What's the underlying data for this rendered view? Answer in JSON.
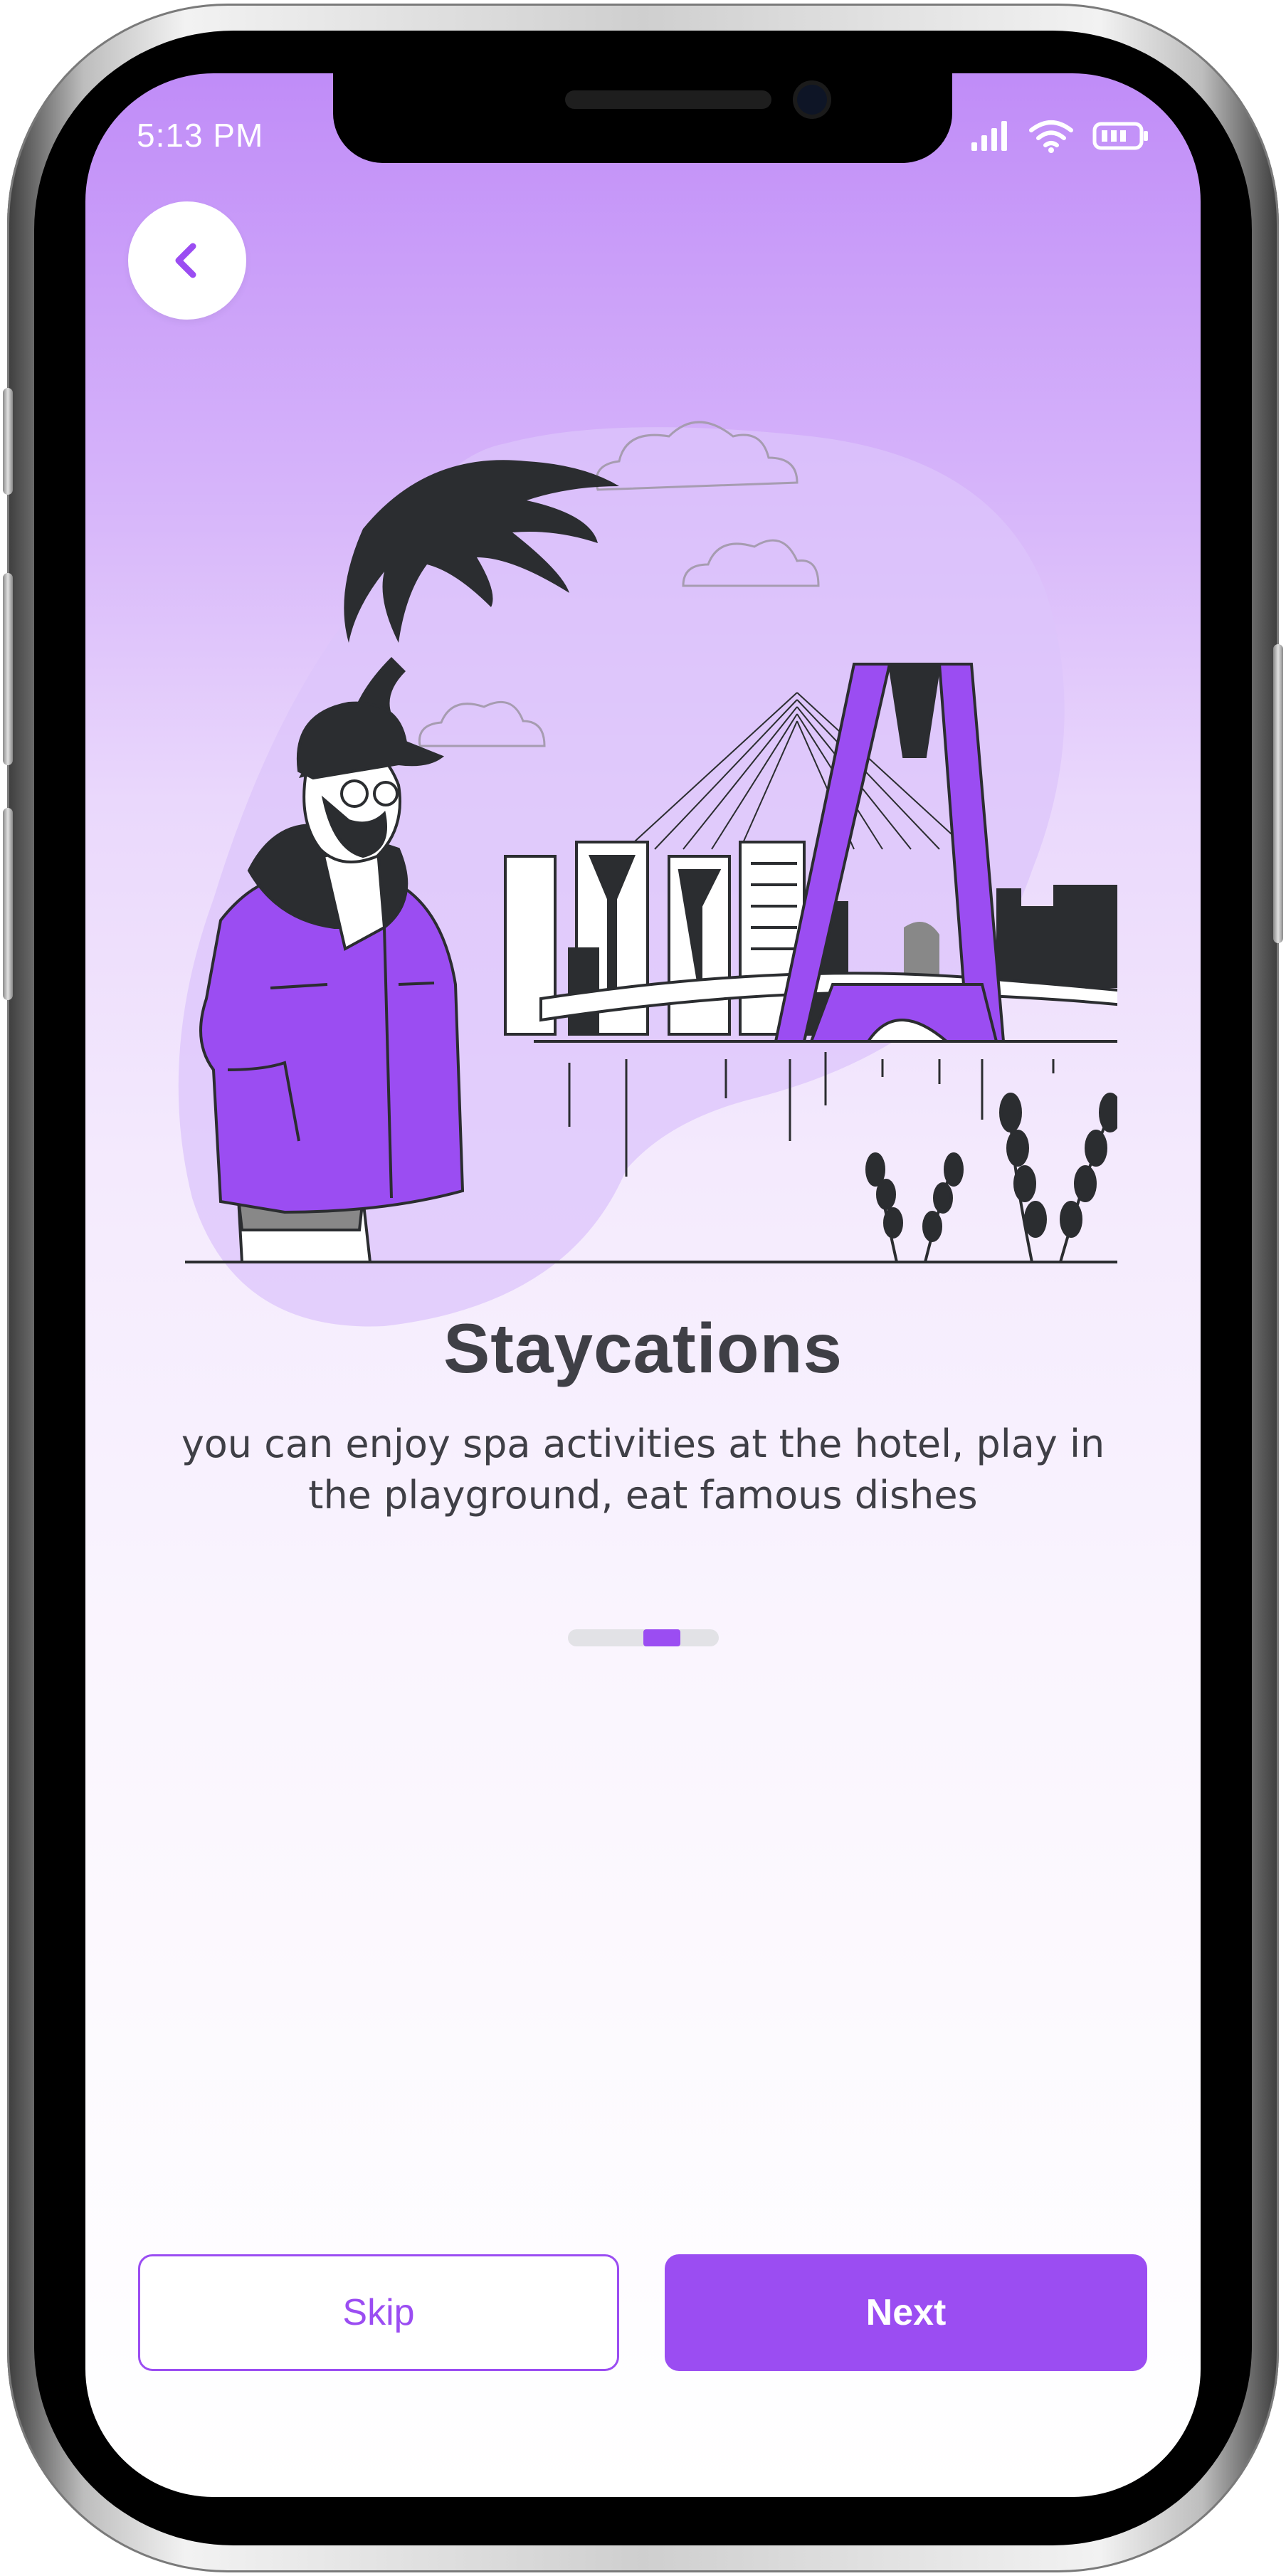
{
  "status_bar": {
    "time": "5:13 PM",
    "icons": [
      "signal-icon",
      "wifi-icon",
      "battery-icon"
    ]
  },
  "nav": {
    "back_icon": "chevron-left-icon"
  },
  "onboarding": {
    "title": "Staycations",
    "description": "you can enjoy spa activities at the hotel, play in the playground, eat famous dishes",
    "pager": {
      "total": 3,
      "current": 2
    }
  },
  "actions": {
    "skip_label": "Skip",
    "next_label": "Next"
  },
  "colors": {
    "accent": "#9b4df2",
    "text": "#3f3f46",
    "illustration_dark": "#2b2d30",
    "bg_top": "#c08cf8"
  }
}
